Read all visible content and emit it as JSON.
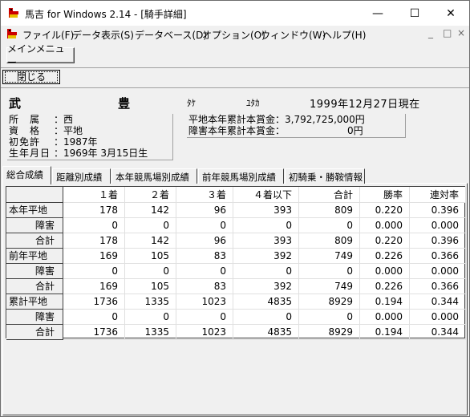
{
  "window": {
    "title": "馬吉 for Windows 2.14 - [騎手詳細]",
    "min_glyph": "—",
    "max_glyph": "☐",
    "close_glyph": "✕"
  },
  "menu": {
    "items": [
      "ファイル(F)",
      "データ表示(S)",
      "データベース(D)",
      "オプション(O)",
      "ウィンドウ(W)",
      "ヘルプ(H)"
    ],
    "mdi_min": "_",
    "mdi_restore": "□",
    "mdi_close": "×"
  },
  "toolbar": {
    "main_menu": "メインメニュー",
    "close": "閉じる"
  },
  "jockey": {
    "surname": "武",
    "given": "豊",
    "kana_surname": "ﾀｹ",
    "kana_given": "ﾕﾀｶ",
    "as_of": "1999年12月27日現在",
    "affiliation_label": "所　属",
    "affiliation": "：西",
    "qualification_label": "資　格",
    "qualification": "：平地",
    "license_label": "初免許",
    "license": "：1987年",
    "birth_label": "生年月日",
    "birth": "：1969年 3月15日生",
    "flat_prize": "平地本年累計本賞金：3,792,725,000円",
    "jump_prize": "障害本年累計本賞金：　　　　　　　0円"
  },
  "tabs": [
    "総合成績",
    "距離別成績",
    "本年競馬場別成績",
    "前年競馬場別成績",
    "初騎乗・勝鞍情報"
  ],
  "table": {
    "headers": [
      "１着",
      "２着",
      "３着",
      "４着以下",
      "合計",
      "勝率",
      "連対率"
    ],
    "rows": [
      {
        "label": "本年平地",
        "type": "main",
        "values": [
          "178",
          "142",
          "96",
          "393",
          "809",
          "0.220",
          "0.396"
        ]
      },
      {
        "label": "障害",
        "type": "sub",
        "values": [
          "0",
          "0",
          "0",
          "0",
          "0",
          "0.000",
          "0.000"
        ]
      },
      {
        "label": "合計",
        "type": "sub",
        "values": [
          "178",
          "142",
          "96",
          "393",
          "809",
          "0.220",
          "0.396"
        ]
      },
      {
        "label": "前年平地",
        "type": "main",
        "values": [
          "169",
          "105",
          "83",
          "392",
          "749",
          "0.226",
          "0.366"
        ]
      },
      {
        "label": "障害",
        "type": "sub",
        "values": [
          "0",
          "0",
          "0",
          "0",
          "0",
          "0.000",
          "0.000"
        ]
      },
      {
        "label": "合計",
        "type": "sub",
        "values": [
          "169",
          "105",
          "83",
          "392",
          "749",
          "0.226",
          "0.366"
        ]
      },
      {
        "label": "累計平地",
        "type": "main",
        "values": [
          "1736",
          "1335",
          "1023",
          "4835",
          "8929",
          "0.194",
          "0.344"
        ]
      },
      {
        "label": "障害",
        "type": "sub",
        "values": [
          "0",
          "0",
          "0",
          "0",
          "0",
          "0.000",
          "0.000"
        ]
      },
      {
        "label": "合計",
        "type": "sub",
        "values": [
          "1736",
          "1335",
          "1023",
          "4835",
          "8929",
          "0.194",
          "0.344"
        ]
      }
    ]
  },
  "colors": {
    "icon_red": "#cc0000",
    "icon_yellow": "#e8c000",
    "window_bg": "#f0f0f0"
  }
}
